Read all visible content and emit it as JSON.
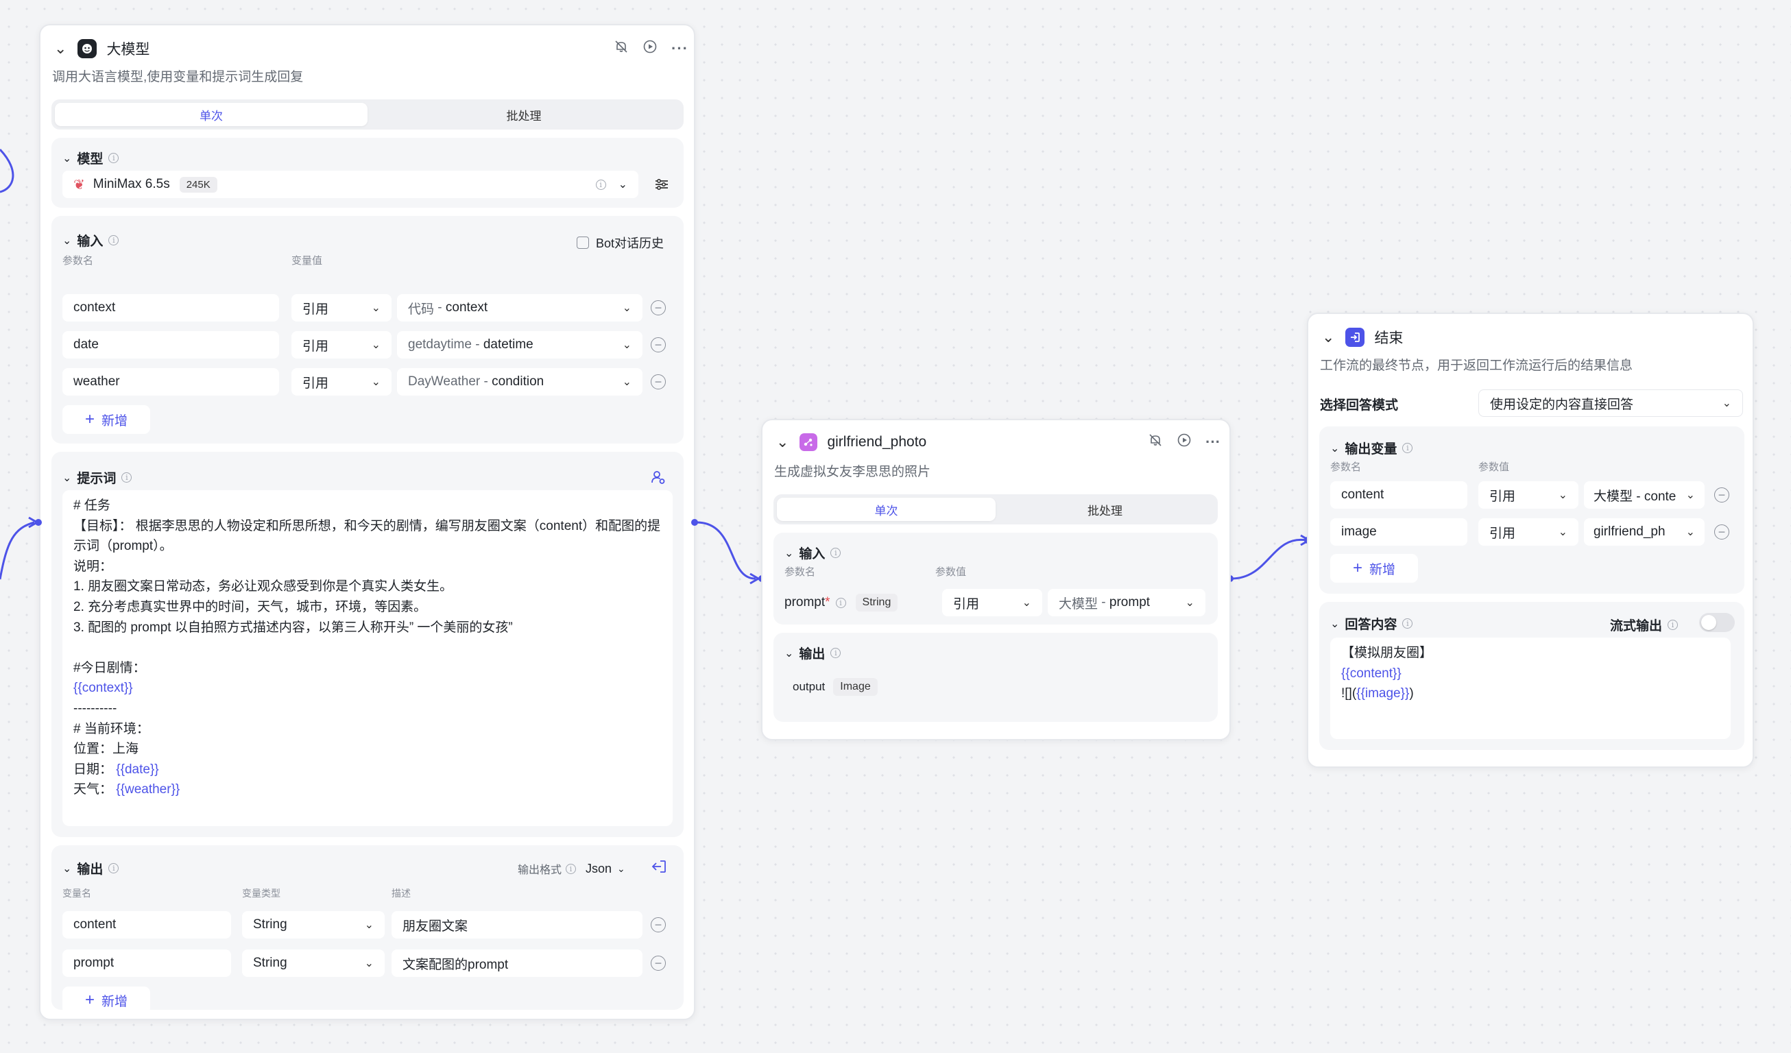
{
  "llm_node": {
    "title": "大模型",
    "description": "调用大语言模型,使用变量和提示词生成回复",
    "tabs": [
      "单次",
      "批处理"
    ],
    "model": {
      "label": "模型",
      "name": "MiniMax 6.5s",
      "context_badge": "245K"
    },
    "input": {
      "label": "输入",
      "history_label": "Bot对话历史",
      "col_param": "参数名",
      "col_value": "变量值",
      "rows": [
        {
          "name": "context",
          "type": "引用",
          "source": "代码",
          "field": "context"
        },
        {
          "name": "date",
          "type": "引用",
          "source": "getdaytime",
          "field": "datetime"
        },
        {
          "name": "weather",
          "type": "引用",
          "source": "DayWeather",
          "field": "condition"
        }
      ],
      "add_label": "新增"
    },
    "prompt": {
      "label": "提示词",
      "lines": [
        [
          {
            "t": "# 任务"
          }
        ],
        [
          {
            "t": "【目标】： 根据李思思的人物设定和所思所想，和今天的剧情，编写朋友圈文案（content）和配图的提"
          }
        ],
        [
          {
            "t": "示词（prompt）。"
          }
        ],
        [
          {
            "t": "说明："
          }
        ],
        [
          {
            "t": "1. 朋友圈文案日常动态，务必让观众感受到你是个真实人类女生。"
          }
        ],
        [
          {
            "t": "2. 充分考虑真实世界中的时间，天气，城市，环境，等因素。"
          }
        ],
        [
          {
            "t": "3. 配图的 prompt 以自拍照方式描述内容，以第三人称开头” 一个美丽的女孩”"
          }
        ],
        [
          {
            "t": ""
          }
        ],
        [
          {
            "t": "#今日剧情："
          }
        ],
        [
          {
            "t": "{{context}}",
            "v": true
          }
        ],
        [
          {
            "t": "----------"
          }
        ],
        [
          {
            "t": "# 当前环境："
          }
        ],
        [
          {
            "t": "位置：上海"
          }
        ],
        [
          {
            "t": "日期：  "
          },
          {
            "t": "{{date}}",
            "v": true
          }
        ],
        [
          {
            "t": "天气：  "
          },
          {
            "t": "{{weather}}",
            "v": true
          }
        ]
      ]
    },
    "output": {
      "label": "输出",
      "format_label": "输出格式",
      "format_value": "Json",
      "col_name": "变量名",
      "col_type": "变量类型",
      "col_desc": "描述",
      "rows": [
        {
          "name": "content",
          "type": "String",
          "desc": "朋友圈文案"
        },
        {
          "name": "prompt",
          "type": "String",
          "desc": "文案配图的prompt"
        }
      ],
      "add_label": "新增"
    }
  },
  "photo_node": {
    "title": "girlfriend_photo",
    "description": "生成虚拟女友李思思的照片",
    "tabs": [
      "单次",
      "批处理"
    ],
    "input": {
      "label": "输入",
      "col_param": "参数名",
      "col_value": "参数值",
      "row": {
        "name": "prompt",
        "required_mark": "*",
        "type_badge": "String",
        "type": "引用",
        "source": "大模型",
        "field": "prompt"
      }
    },
    "output": {
      "label": "输出",
      "name": "output",
      "type_badge": "Image"
    }
  },
  "end_node": {
    "title": "结束",
    "description": "工作流的最终节点，用于返回工作流运行后的结果信息",
    "mode_label": "选择回答模式",
    "mode_value": "使用设定的内容直接回答",
    "output_vars": {
      "label": "输出变量",
      "col_param": "参数名",
      "col_value": "参数值",
      "rows": [
        {
          "name": "content",
          "type": "引用",
          "value": "大模型 - conte"
        },
        {
          "name": "image",
          "type": "引用",
          "value": "girlfriend_ph"
        }
      ],
      "add_label": "新增"
    },
    "answer": {
      "label": "回答内容",
      "stream_label": "流式输出",
      "lines": [
        [
          {
            "t": "【模拟朋友圈】"
          }
        ],
        [
          {
            "t": "{{content}}",
            "v": true
          }
        ],
        [
          {
            "t": "![]("
          },
          {
            "t": "{{image}}",
            "v": true
          },
          {
            "t": ")"
          }
        ]
      ]
    }
  },
  "colors": {
    "accent": "#4d53e8",
    "photo_icon": "#c86ae8",
    "end_icon": "#4d53e8"
  }
}
